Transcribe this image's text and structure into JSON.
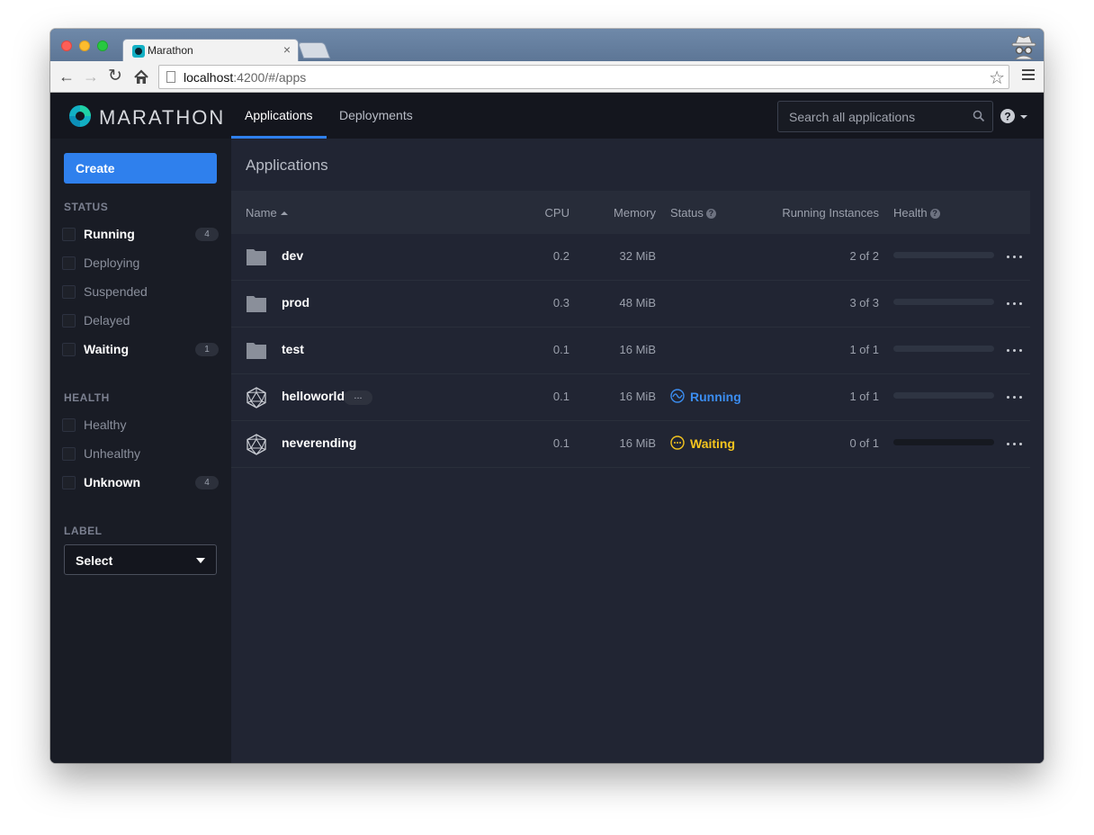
{
  "browser": {
    "tab_title": "Marathon",
    "tab_close": "×",
    "url_host": "localhost",
    "url_rest": ":4200/#/apps"
  },
  "navbar": {
    "brand": "MARATHON",
    "tabs": [
      {
        "label": "Applications",
        "active": true
      },
      {
        "label": "Deployments",
        "active": false
      }
    ],
    "search_placeholder": "Search all applications"
  },
  "sidebar": {
    "create_label": "Create",
    "status_heading": "STATUS",
    "status_filters": [
      {
        "label": "Running",
        "count": "4",
        "emphasized": true
      },
      {
        "label": "Deploying",
        "count": null,
        "emphasized": false
      },
      {
        "label": "Suspended",
        "count": null,
        "emphasized": false
      },
      {
        "label": "Delayed",
        "count": null,
        "emphasized": false
      },
      {
        "label": "Waiting",
        "count": "1",
        "emphasized": true
      }
    ],
    "health_heading": "HEALTH",
    "health_filters": [
      {
        "label": "Healthy",
        "count": null,
        "emphasized": false
      },
      {
        "label": "Unhealthy",
        "count": null,
        "emphasized": false
      },
      {
        "label": "Unknown",
        "count": "4",
        "emphasized": true
      }
    ],
    "label_heading": "LABEL",
    "label_select_value": "Select"
  },
  "main": {
    "title": "Applications",
    "columns": {
      "name": "Name",
      "cpu": "CPU",
      "memory": "Memory",
      "status": "Status",
      "running_instances": "Running Instances",
      "health": "Health"
    },
    "rows": [
      {
        "name": "dev",
        "type": "folder",
        "cpu": "0.2",
        "memory": "32 MiB",
        "status": "",
        "instances": "2 of 2",
        "health_bar": "empty"
      },
      {
        "name": "prod",
        "type": "folder",
        "cpu": "0.3",
        "memory": "48 MiB",
        "status": "",
        "instances": "3 of 3",
        "health_bar": "empty"
      },
      {
        "name": "test",
        "type": "folder",
        "cpu": "0.1",
        "memory": "16 MiB",
        "status": "",
        "instances": "1 of 1",
        "health_bar": "empty"
      },
      {
        "name": "helloworld",
        "type": "app",
        "labels_badge": "...",
        "cpu": "0.1",
        "memory": "16 MiB",
        "status": "Running",
        "instances": "1 of 1",
        "health_bar": "empty"
      },
      {
        "name": "neverending",
        "type": "app",
        "cpu": "0.1",
        "memory": "16 MiB",
        "status": "Waiting",
        "instances": "0 of 1",
        "health_bar": "none"
      }
    ]
  },
  "colors": {
    "accent": "#2f80ed",
    "running": "#3b8df0",
    "waiting": "#f5c51e"
  }
}
